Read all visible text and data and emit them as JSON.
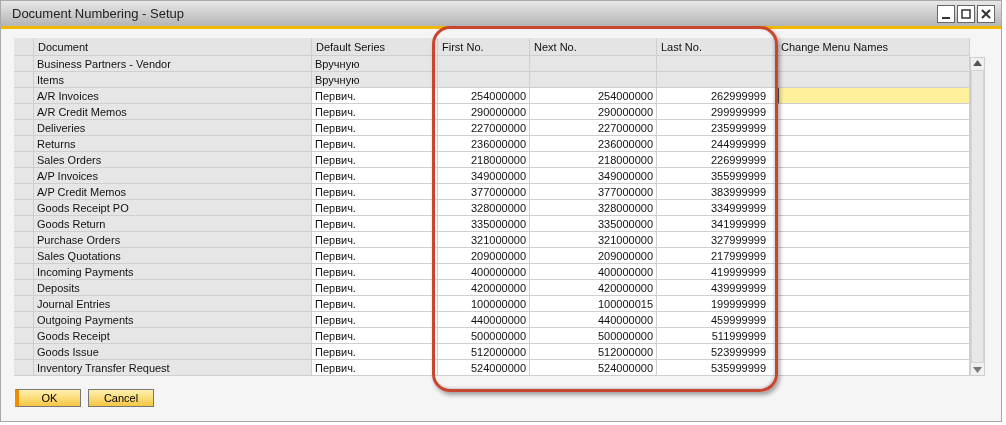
{
  "window": {
    "title": "Document Numbering - Setup"
  },
  "table": {
    "columns": [
      "Document",
      "Default Series",
      "First No.",
      "Next No.",
      "Last No.",
      "Change Menu Names"
    ],
    "rows": [
      {
        "document": "Business Partners - Vendor",
        "series": "Вручную",
        "first": "",
        "next": "",
        "last": "",
        "disabled": true,
        "selected": false
      },
      {
        "document": "Items",
        "series": "Вручную",
        "first": "",
        "next": "",
        "last": "",
        "disabled": true,
        "selected": false
      },
      {
        "document": "A/R Invoices",
        "series": "Первич.",
        "first": "254000000",
        "next": "254000000",
        "last": "262999999",
        "disabled": false,
        "selected": true
      },
      {
        "document": "A/R Credit Memos",
        "series": "Первич.",
        "first": "290000000",
        "next": "290000000",
        "last": "299999999",
        "disabled": false,
        "selected": false
      },
      {
        "document": "Deliveries",
        "series": "Первич.",
        "first": "227000000",
        "next": "227000000",
        "last": "235999999",
        "disabled": false,
        "selected": false
      },
      {
        "document": "Returns",
        "series": "Первич.",
        "first": "236000000",
        "next": "236000000",
        "last": "244999999",
        "disabled": false,
        "selected": false
      },
      {
        "document": "Sales Orders",
        "series": "Первич.",
        "first": "218000000",
        "next": "218000000",
        "last": "226999999",
        "disabled": false,
        "selected": false
      },
      {
        "document": "A/P Invoices",
        "series": "Первич.",
        "first": "349000000",
        "next": "349000000",
        "last": "355999999",
        "disabled": false,
        "selected": false
      },
      {
        "document": "A/P Credit Memos",
        "series": "Первич.",
        "first": "377000000",
        "next": "377000000",
        "last": "383999999",
        "disabled": false,
        "selected": false
      },
      {
        "document": "Goods Receipt PO",
        "series": "Первич.",
        "first": "328000000",
        "next": "328000000",
        "last": "334999999",
        "disabled": false,
        "selected": false
      },
      {
        "document": "Goods Return",
        "series": "Первич.",
        "first": "335000000",
        "next": "335000000",
        "last": "341999999",
        "disabled": false,
        "selected": false
      },
      {
        "document": "Purchase Orders",
        "series": "Первич.",
        "first": "321000000",
        "next": "321000000",
        "last": "327999999",
        "disabled": false,
        "selected": false
      },
      {
        "document": "Sales Quotations",
        "series": "Первич.",
        "first": "209000000",
        "next": "209000000",
        "last": "217999999",
        "disabled": false,
        "selected": false
      },
      {
        "document": "Incoming Payments",
        "series": "Первич.",
        "first": "400000000",
        "next": "400000000",
        "last": "419999999",
        "disabled": false,
        "selected": false
      },
      {
        "document": "Deposits",
        "series": "Первич.",
        "first": "420000000",
        "next": "420000000",
        "last": "439999999",
        "disabled": false,
        "selected": false
      },
      {
        "document": "Journal Entries",
        "series": "Первич.",
        "first": "100000000",
        "next": "100000015",
        "last": "199999999",
        "disabled": false,
        "selected": false
      },
      {
        "document": "Outgoing Payments",
        "series": "Первич.",
        "first": "440000000",
        "next": "440000000",
        "last": "459999999",
        "disabled": false,
        "selected": false
      },
      {
        "document": "Goods Receipt",
        "series": "Первич.",
        "first": "500000000",
        "next": "500000000",
        "last": "511999999",
        "disabled": false,
        "selected": false
      },
      {
        "document": "Goods Issue",
        "series": "Первич.",
        "first": "512000000",
        "next": "512000000",
        "last": "523999999",
        "disabled": false,
        "selected": false
      },
      {
        "document": "Inventory Transfer Request",
        "series": "Первич.",
        "first": "524000000",
        "next": "524000000",
        "last": "535999999",
        "disabled": false,
        "selected": false
      }
    ]
  },
  "buttons": [
    "OK",
    "Cancel"
  ]
}
